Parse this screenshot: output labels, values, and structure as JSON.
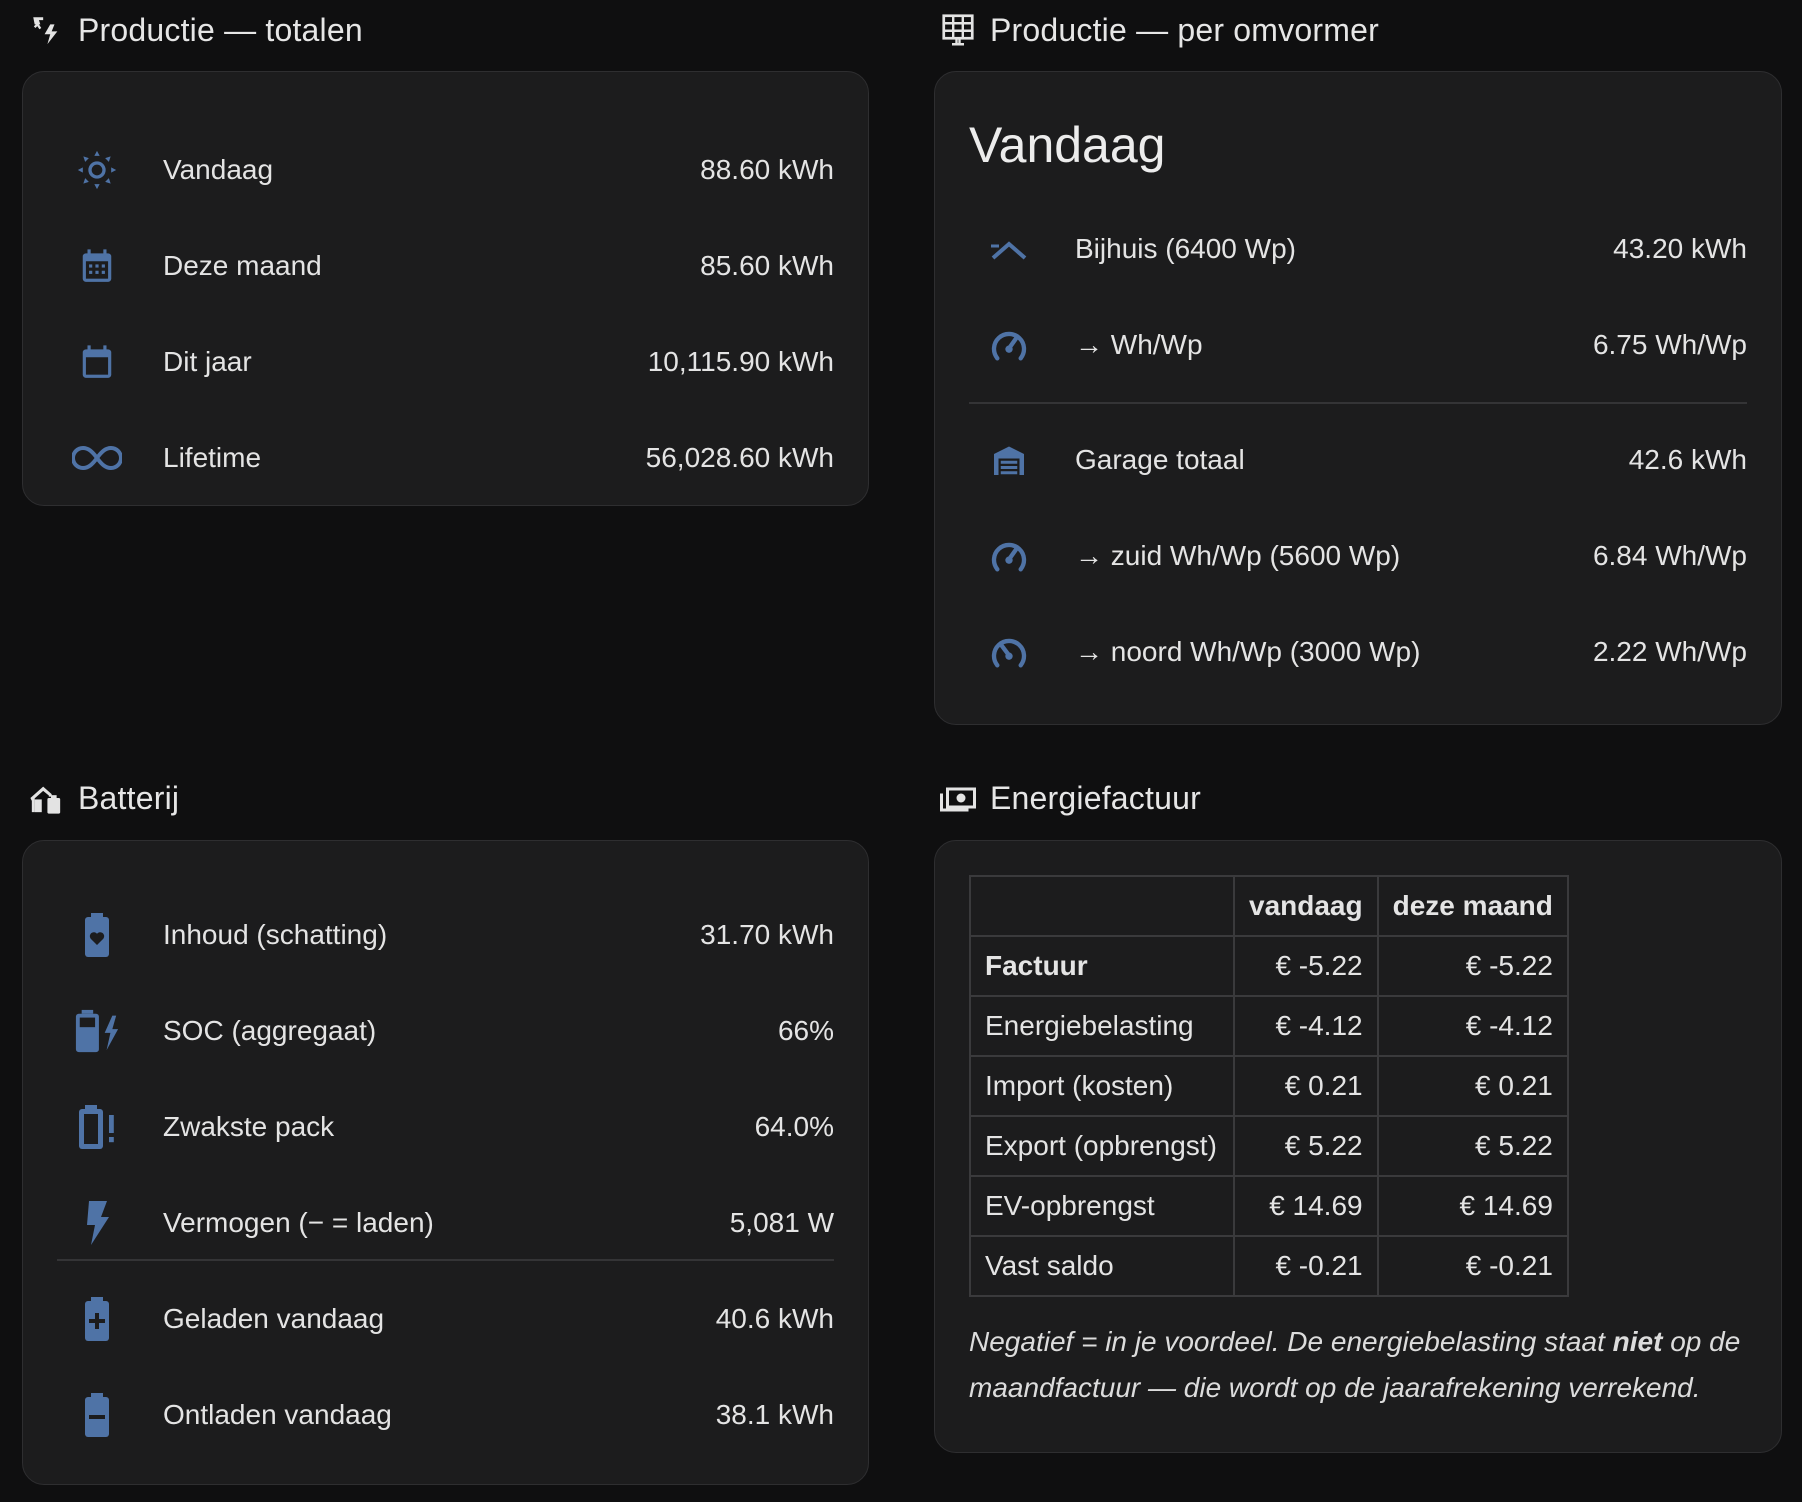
{
  "colors": {
    "icon": "#4f73a6",
    "card": "#1c1c1d",
    "background": "#0f0f10"
  },
  "productie_totalen": {
    "title": "Productie — totalen",
    "icon": "solar-power-icon",
    "rows": [
      {
        "icon": "sun-icon",
        "label": "Vandaag",
        "value": "88.60 kWh"
      },
      {
        "icon": "calendar-month-icon",
        "label": "Deze maand",
        "value": "85.60 kWh"
      },
      {
        "icon": "calendar-blank-icon",
        "label": "Dit jaar",
        "value": "10,115.90 kWh"
      },
      {
        "icon": "infinity-icon",
        "label": "Lifetime",
        "value": "56,028.60 kWh"
      }
    ]
  },
  "productie_omvormer": {
    "title": "Productie — per omvormer",
    "icon": "solar-panel-icon",
    "heading": "Vandaag",
    "rows": [
      {
        "icon": "roof-icon",
        "label": "Bijhuis (6400 Wp)",
        "value": "43.20 kWh"
      },
      {
        "icon": "gauge-icon",
        "label": "→ Wh/Wp",
        "value": "6.75 Wh/Wp"
      },
      {
        "icon": "garage-icon",
        "label": "Garage totaal",
        "value": "42.6 kWh"
      },
      {
        "icon": "gauge-icon",
        "label": "→ zuid Wh/Wp (5600 Wp)",
        "value": "6.84 Wh/Wp"
      },
      {
        "icon": "gauge-low-icon",
        "label": "→ noord Wh/Wp (3000 Wp)",
        "value": "2.22 Wh/Wp"
      }
    ]
  },
  "batterij": {
    "title": "Batterij",
    "icon": "home-battery-icon",
    "rows": [
      {
        "icon": "battery-heart-icon",
        "label": "Inhoud (schatting)",
        "value": "31.70 kWh"
      },
      {
        "icon": "battery-charging-icon",
        "label": "SOC (aggregaat)",
        "value": "66%"
      },
      {
        "icon": "battery-alert-icon",
        "label": "Zwakste pack",
        "value": "64.0%"
      },
      {
        "icon": "flash-icon",
        "label": "Vermogen (− = laden)",
        "value": "5,081 W"
      },
      {
        "icon": "battery-plus-icon",
        "label": "Geladen vandaag",
        "value": "40.6 kWh"
      },
      {
        "icon": "battery-minus-icon",
        "label": "Ontladen vandaag",
        "value": "38.1 kWh"
      }
    ]
  },
  "energiefactuur": {
    "title": "Energiefactuur",
    "icon": "cash-icon",
    "columns": [
      "",
      "vandaag",
      "deze maand"
    ],
    "rows": [
      {
        "label": "Factuur",
        "vandaag": "€ -5.22",
        "maand": "€ -5.22"
      },
      {
        "label": "Energiebelasting",
        "vandaag": "€ -4.12",
        "maand": "€ -4.12"
      },
      {
        "label": "Import (kosten)",
        "vandaag": "€ 0.21",
        "maand": "€ 0.21"
      },
      {
        "label": "Export (opbrengst)",
        "vandaag": "€ 5.22",
        "maand": "€ 5.22"
      },
      {
        "label": "EV-opbrengst",
        "vandaag": "€ 14.69",
        "maand": "€ 14.69"
      },
      {
        "label": "Vast saldo",
        "vandaag": "€ -0.21",
        "maand": "€ -0.21"
      }
    ],
    "note_part1": "Negatief = in je voordeel. De energiebelasting staat ",
    "note_bold": "niet",
    "note_part2": " op de maandfactuur — die wordt op de jaarafrekening verrekend."
  }
}
